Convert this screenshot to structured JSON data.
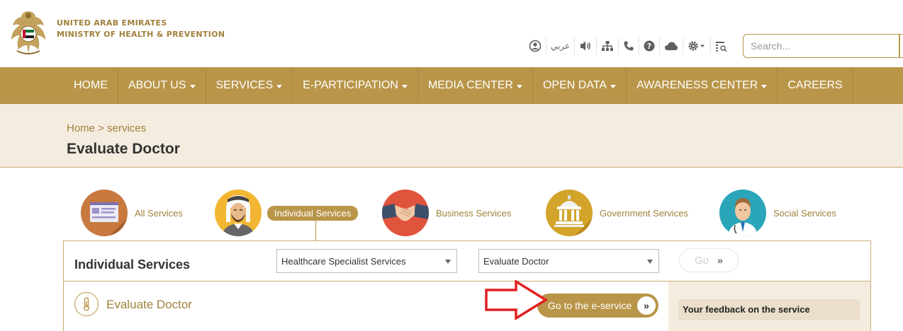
{
  "header": {
    "ministry_line1": "UNITED ARAB EMIRATES",
    "ministry_line2": "MINISTRY OF HEALTH & PREVENTION",
    "toolbar": {
      "arabic_label": "عربي",
      "icons": [
        "user-icon",
        "language-link",
        "speaker-icon",
        "sitemap-icon",
        "phone-icon",
        "help-icon",
        "cloud-icon",
        "settings-icon",
        "list-icon"
      ]
    },
    "search_placeholder": "Search..."
  },
  "nav": {
    "items": [
      {
        "label": "HOME",
        "dropdown": false
      },
      {
        "label": "ABOUT US",
        "dropdown": true
      },
      {
        "label": "SERVICES",
        "dropdown": true
      },
      {
        "label": "E-PARTICIPATION",
        "dropdown": true
      },
      {
        "label": "MEDIA CENTER",
        "dropdown": true
      },
      {
        "label": "OPEN DATA",
        "dropdown": true
      },
      {
        "label": "AWARENESS CENTER",
        "dropdown": true
      },
      {
        "label": "CAREERS",
        "dropdown": false
      }
    ]
  },
  "breadcrumb": {
    "home": "Home",
    "sep": " > ",
    "current": "services"
  },
  "page_title": "Evaluate Doctor",
  "categories": [
    {
      "label": "All Services"
    },
    {
      "label": "Individual Services",
      "active": true
    },
    {
      "label": "Business Services"
    },
    {
      "label": "Government Services"
    },
    {
      "label": "Social Services"
    }
  ],
  "panel": {
    "title": "Individual Services",
    "select1": "Healthcare Specialist Services",
    "select2": "Evaluate Doctor",
    "go_label": "Go",
    "go_chevron": "»",
    "service_name": "Evaluate Doctor",
    "eservice_label": "Go to the e-service",
    "eservice_chevron": "»",
    "feedback_label": "Your feedback on the service"
  },
  "colors": {
    "gold": "#b89548",
    "gold_text": "#a0813b",
    "band_bg": "#f5ece0",
    "annotation_arrow": "#e02020"
  }
}
